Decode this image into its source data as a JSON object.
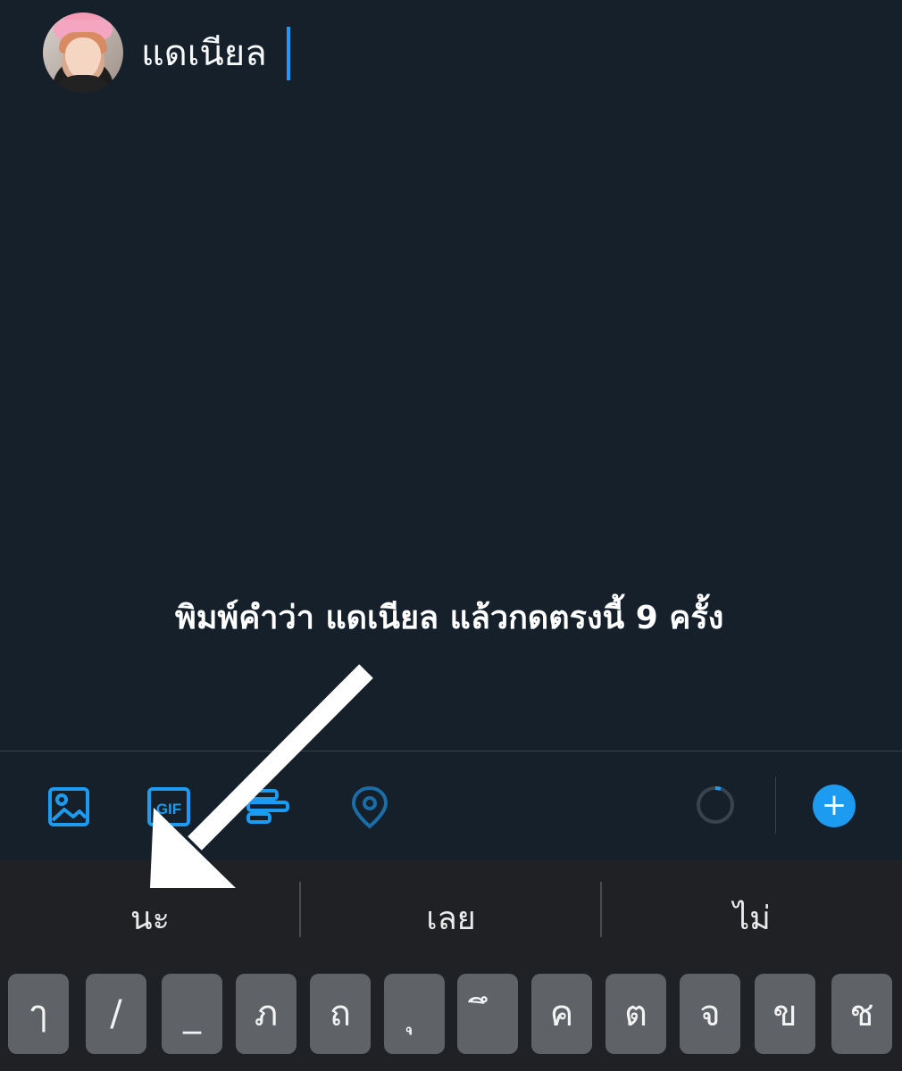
{
  "compose": {
    "typed_text": "แดเนียล",
    "instruction": "พิมพ์คำว่า แดเนียล แล้วกดตรงนี้ 9 ครั้ง"
  },
  "toolbar": {
    "gif_label": "GIF",
    "add_label": "+",
    "icons": [
      "image-icon",
      "gif-icon",
      "poll-icon",
      "location-icon",
      "progress-ring-icon",
      "plus-icon"
    ]
  },
  "keyboard": {
    "suggestions": [
      "นะ",
      "เลย",
      "ไม่"
    ],
    "keys": [
      "ๅ",
      "/",
      "_",
      "ภ",
      "ถ",
      "ุ",
      "ึ",
      "ค",
      "ต",
      "จ",
      "ข",
      "ช"
    ]
  },
  "colors": {
    "background": "#15202b",
    "accent": "#1d9bf0",
    "keyboard_bg": "#202124",
    "key_bg": "#5f6368"
  }
}
